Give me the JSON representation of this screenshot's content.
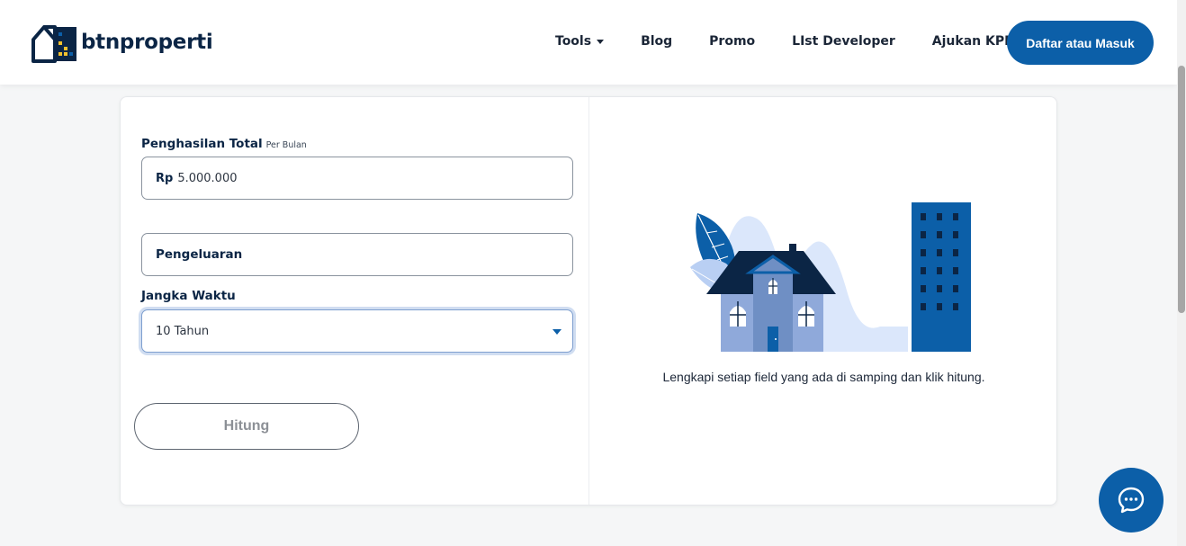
{
  "header": {
    "logo_text": "btnproperti",
    "nav": [
      {
        "label": "Tools",
        "has_dropdown": true
      },
      {
        "label": "Blog"
      },
      {
        "label": "Promo"
      },
      {
        "label": "LIst Developer"
      },
      {
        "label": "Ajukan KPR"
      }
    ],
    "login_label": "Daftar atau Masuk"
  },
  "form": {
    "income": {
      "label": "Penghasilan Total",
      "sublabel": "Per Bulan",
      "prefix": "Rp",
      "value": "5.000.000"
    },
    "expense": {
      "placeholder": "Pengeluaran"
    },
    "term": {
      "label": "Jangka Waktu",
      "selected": "10 Tahun"
    },
    "submit_label": "Hitung"
  },
  "result": {
    "hint": "Lengkapi setiap field yang ada di samping dan klik hitung."
  },
  "colors": {
    "brand_blue": "#0c5fa8",
    "navy": "#0b2545",
    "accent_yellow": "#f2c12e"
  },
  "icons": {
    "logo": "house-logo-icon",
    "dropdown": "caret-down-icon",
    "chat": "chat-bubble-icon"
  }
}
